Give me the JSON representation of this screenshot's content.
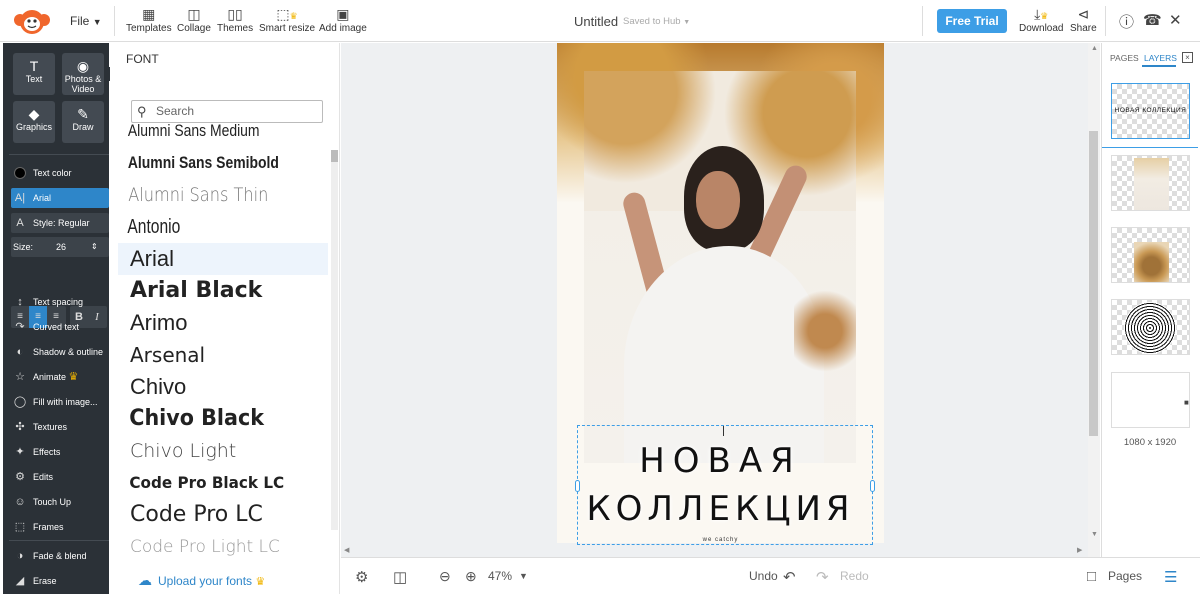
{
  "topbar": {
    "file_label": "File",
    "tools": [
      {
        "label": "Templates",
        "icon": "templates-icon"
      },
      {
        "label": "Collage",
        "icon": "collage-icon"
      },
      {
        "label": "Themes",
        "icon": "themes-icon"
      },
      {
        "label": "Smart resize",
        "icon": "smart-resize-icon",
        "premium": true
      },
      {
        "label": "Add image",
        "icon": "add-image-icon"
      }
    ],
    "doc_title": "Untitled",
    "saved_status": "Saved to Hub",
    "free_trial_label": "Free Trial",
    "download_label": "Download",
    "share_label": "Share",
    "accent_color": "#3d9ee6"
  },
  "left_sidebar": {
    "big_buttons": [
      {
        "label": "Text",
        "icon": "text-icon"
      },
      {
        "label": "Photos & Video",
        "icon": "camera-icon"
      },
      {
        "label": "Graphics",
        "icon": "graphics-icon"
      },
      {
        "label": "Draw",
        "icon": "draw-icon"
      }
    ],
    "text_color_label": "Text color",
    "text_color_value": "#000000",
    "font_label": "Arial",
    "style_label": "Style: Regular",
    "size_label": "Size:",
    "size_value": "26",
    "bold_label": "B",
    "italic_label": "I",
    "items": [
      {
        "label": "Text spacing",
        "icon": "text-spacing-icon"
      },
      {
        "label": "Curved text",
        "icon": "curved-text-icon"
      },
      {
        "label": "Shadow & outline",
        "icon": "shadow-outline-icon"
      },
      {
        "label": "Animate",
        "icon": "star-icon",
        "premium": true
      },
      {
        "label": "Fill with image...",
        "icon": "fill-image-icon"
      },
      {
        "label": "Textures",
        "icon": "textures-icon"
      },
      {
        "label": "Effects",
        "icon": "effects-icon"
      },
      {
        "label": "Edits",
        "icon": "edits-icon"
      },
      {
        "label": "Touch Up",
        "icon": "touch-up-icon"
      },
      {
        "label": "Frames",
        "icon": "frames-icon"
      },
      {
        "label": "Fade & blend",
        "icon": "fade-blend-icon"
      },
      {
        "label": "Erase",
        "icon": "erase-icon"
      }
    ]
  },
  "font_panel": {
    "title": "FONT",
    "search_placeholder": "Search",
    "fonts": [
      "Alumni Sans Medium",
      "Alumni Sans Semibold",
      "Alumni Sans Thin",
      "Antonio",
      "Arial",
      "Arial Black",
      "Arimo",
      "Arsenal",
      "Chivo",
      "Chivo Black",
      "Chivo Light",
      "Code Pro Black LC",
      "Code Pro LC",
      "Code Pro Light LC"
    ],
    "selected_font": "Arial",
    "upload_label": "Upload your fonts"
  },
  "canvas": {
    "headline_line1": "НОВАЯ",
    "headline_line2": "КОЛЛЕКЦИЯ",
    "small_text": "we catchy"
  },
  "bottombar": {
    "zoom": "47%",
    "undo_label": "Undo",
    "redo_label": "Redo",
    "pages_label": "Pages"
  },
  "right_panel": {
    "tab_pages": "PAGES",
    "tab_layers": "LAYERS",
    "layer_text": "НОВАЯ КОЛЛЕКЦИЯ",
    "dimensions": "1080 x 1920"
  }
}
